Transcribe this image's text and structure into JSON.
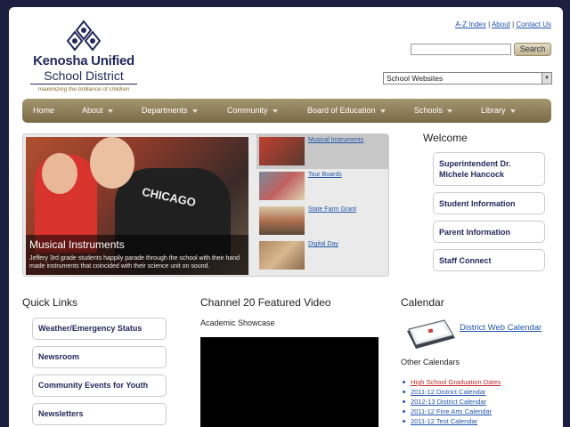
{
  "header": {
    "logo_line1": "Kenosha Unified",
    "logo_line2": "School District",
    "tagline": "maximizing the brilliance of children",
    "links": [
      "A-Z Index",
      "About",
      "Contact Us"
    ],
    "search_button": "Search",
    "search_value": "",
    "site_select": "School Websites"
  },
  "nav": {
    "items": [
      {
        "label": "Home",
        "dropdown": false
      },
      {
        "label": "About",
        "dropdown": true
      },
      {
        "label": "Departments",
        "dropdown": true
      },
      {
        "label": "Community",
        "dropdown": true
      },
      {
        "label": "Board of Education",
        "dropdown": true
      },
      {
        "label": "Schools",
        "dropdown": true
      },
      {
        "label": "Library",
        "dropdown": true
      }
    ]
  },
  "slideshow": {
    "title": "Musical Instruments",
    "description": "Jeffery 3rd grade students happily parade through the school with their hand made instruments that coincided with their science unit on sound.",
    "shirt_text": "CHICAGO",
    "thumbs": [
      "Musical Instruments",
      "Tour Boards",
      "State Farm Grant",
      "Digital Day"
    ]
  },
  "welcome": {
    "title": "Welcome",
    "buttons": [
      "Superintendent Dr. Michele Hancock",
      "Student Information",
      "Parent Information",
      "Staff Connect"
    ]
  },
  "quick_links": {
    "title": "Quick Links",
    "items": [
      "Weather/Emergency Status",
      "Newsroom",
      "Community Events for Youth",
      "Newsletters"
    ]
  },
  "video": {
    "title": "Channel 20 Featured Video",
    "subtitle": "Academic Showcase"
  },
  "calendar": {
    "title": "Calendar",
    "main_link": "District Web Calendar",
    "other_title": "Other Calendars",
    "others": [
      "High School Graduation Dates",
      "2011-12 District Calendar",
      "2012-13 District Calendar",
      "2011-12 Fine Arts Calendar",
      "2011-12 Test Calendar"
    ]
  },
  "colors": {
    "navy": "#232a5a",
    "nav_gold": "#8a7a56",
    "link_blue": "#2255aa",
    "highlight_red": "#c0282d"
  }
}
